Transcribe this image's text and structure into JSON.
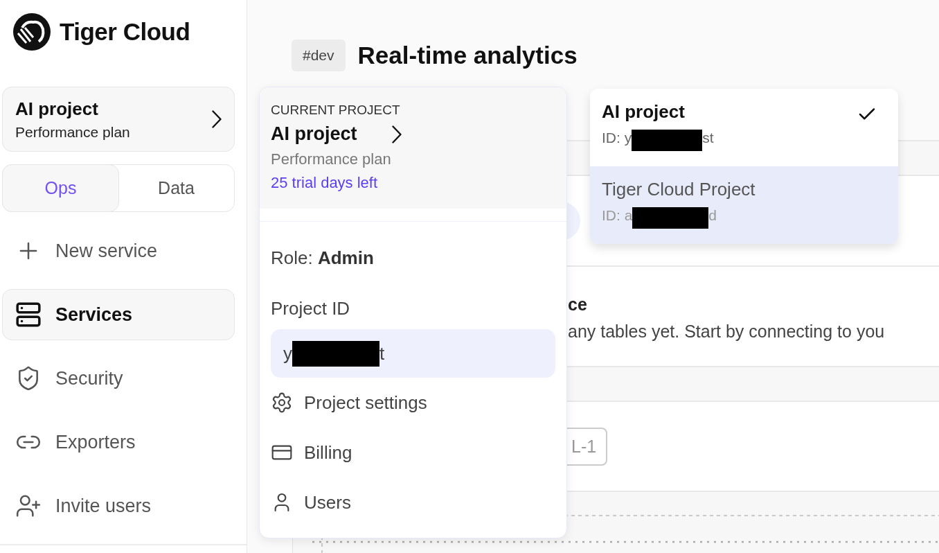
{
  "brand": {
    "name": "Tiger Cloud"
  },
  "sidebar": {
    "project": {
      "name": "AI project",
      "plan": "Performance plan"
    },
    "tabs": [
      {
        "label": "Ops",
        "selected": true
      },
      {
        "label": "Data",
        "selected": false
      }
    ],
    "nav": [
      {
        "label": "New service",
        "selected": false
      },
      {
        "label": "Services",
        "selected": true
      },
      {
        "label": "Security",
        "selected": false
      },
      {
        "label": "Exporters",
        "selected": false
      },
      {
        "label": "Invite users",
        "selected": false
      }
    ]
  },
  "header": {
    "tag": "#dev",
    "title": "Real-time analytics"
  },
  "background": {
    "heading": "ce",
    "text": "any tables yet. Start by connecting to you",
    "tag": "L-1"
  },
  "project_menu": {
    "section_label": "CURRENT PROJECT",
    "name": "AI project",
    "plan": "Performance plan",
    "trial": "25 trial days left",
    "role_line": "Role: **Admin**",
    "id_label": "Project ID",
    "id_start": "y",
    "id_end": "t",
    "items": [
      {
        "label": "Project settings"
      },
      {
        "label": "Billing"
      },
      {
        "label": "Users"
      }
    ]
  },
  "project_list": [
    {
      "name": "AI project",
      "id_start": "ID: y",
      "id_end": "st",
      "selected": true,
      "highlighted": false
    },
    {
      "name": "Tiger Cloud Project",
      "id_start": "ID: a",
      "id_end": "d",
      "selected": false,
      "highlighted": true
    }
  ]
}
